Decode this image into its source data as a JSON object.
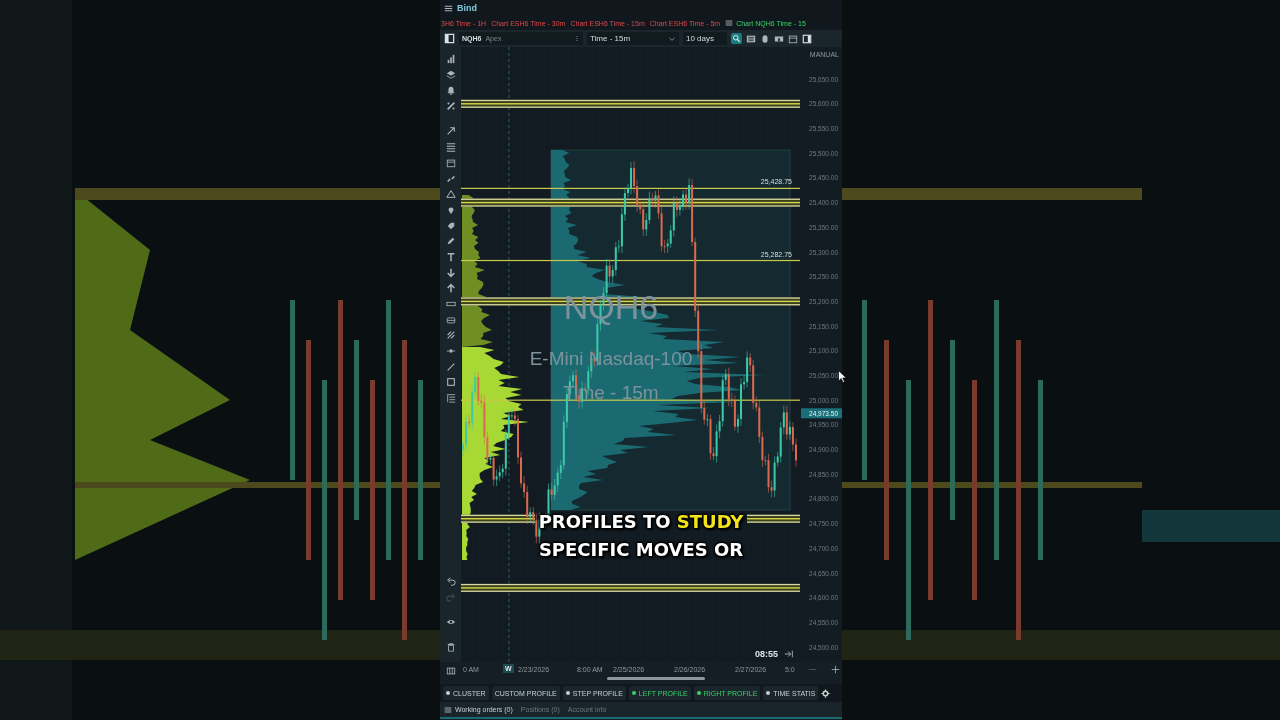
{
  "window": {
    "title": "Bind"
  },
  "chart_tabs": [
    {
      "label": "3H6 Time - 1H",
      "selected": false
    },
    {
      "label": "Chart ESH6 Time - 30m",
      "selected": false
    },
    {
      "label": "Chart ESH6 Time - 15m",
      "selected": false
    },
    {
      "label": "Chart ESH6 Time - 5m",
      "selected": false
    },
    {
      "label": "Chart NQH6 Time - 15",
      "selected": true
    }
  ],
  "toolbar": {
    "symbol": "NQH6",
    "account": "Apex",
    "timeframe": "Time - 15m",
    "range": "10 days"
  },
  "chart": {
    "axis_mode": "MANUAL",
    "watermark": [
      "NQH6",
      "E-Mini Nasdaq-100",
      "Time - 15m"
    ],
    "level_labels": [
      "25,428.75",
      "25,282.75"
    ],
    "last_price": "24,973.50",
    "clock": "08:55",
    "price_axis": [
      "25,650.00",
      "25,600.00",
      "25,550.00",
      "25,500.00",
      "25,450.00",
      "25,400.00",
      "25,350.00",
      "25,300.00",
      "25,250.00",
      "25,200.00",
      "25,150.00",
      "25,100.00",
      "25,050.00",
      "25,000.00",
      "24,950.00",
      "24,900.00",
      "24,850.00",
      "24,800.00",
      "24,750.00",
      "24,700.00",
      "24,650.00",
      "24,600.00",
      "24,550.00",
      "24,500.00"
    ]
  },
  "time_axis": {
    "week_marker": "W",
    "labels": [
      "0 AM",
      "2/23/2026",
      "8:00 AM",
      "2/25/2026",
      "2/26/2026",
      "2/27/2026",
      "5:0"
    ]
  },
  "profile_buttons": [
    {
      "label": "CLUSTER",
      "indicator": true,
      "on": false
    },
    {
      "label": "CUSTOM PROFILE",
      "indicator": false,
      "on": false
    },
    {
      "label": "STEP PROFILE",
      "indicator": true,
      "on": false
    },
    {
      "label": "LEFT PROFILE",
      "indicator": true,
      "on": true
    },
    {
      "label": "RIGHT PROFILE",
      "indicator": true,
      "on": true
    },
    {
      "label": "TIME STATIS",
      "indicator": true,
      "on": false
    }
  ],
  "bottom_tabs": [
    {
      "label": "Working orders (0)",
      "selected": true
    },
    {
      "label": "Positions (0)",
      "selected": false
    },
    {
      "label": "Account info",
      "selected": false
    }
  ],
  "caption": {
    "lines": [
      [
        {
          "text": "PROFILES TO ",
          "highlight": false
        },
        {
          "text": "STUDY",
          "highlight": true
        }
      ],
      [
        {
          "text": "SPECIFIC MOVES OR",
          "highlight": false
        }
      ]
    ]
  }
}
